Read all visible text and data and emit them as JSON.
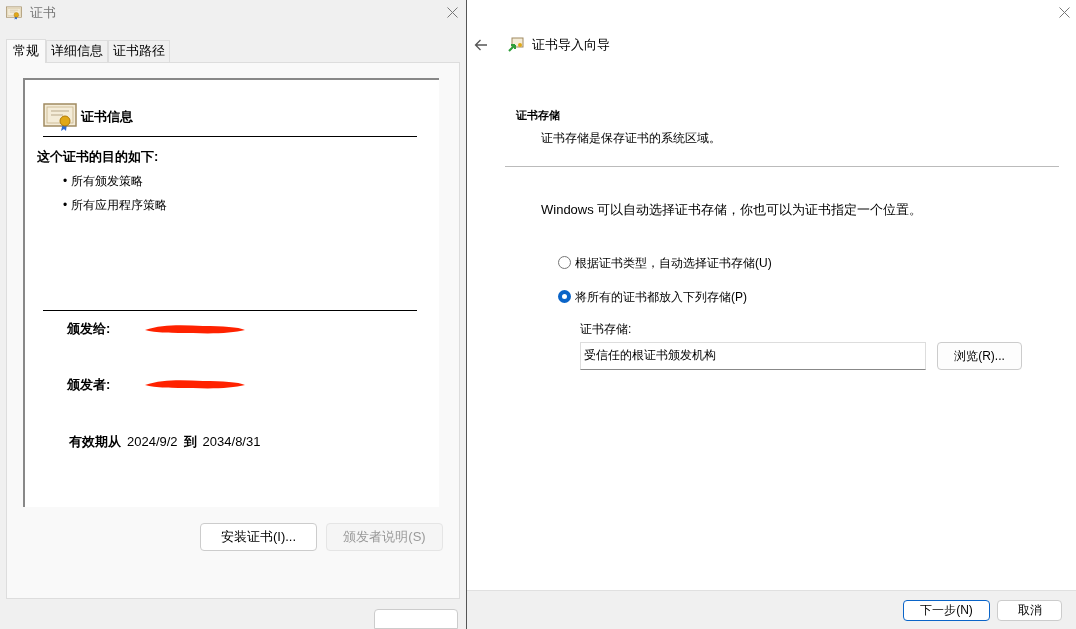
{
  "cert_dialog": {
    "title": "证书",
    "tabs": [
      {
        "label": "常规",
        "selected": true
      },
      {
        "label": "详细信息",
        "selected": false
      },
      {
        "label": "证书路径",
        "selected": false
      }
    ],
    "info_title": "证书信息",
    "purpose_heading": "这个证书的目的如下:",
    "purposes": [
      "• 所有颁发策略",
      "• 所有应用程序策略"
    ],
    "fields": [
      {
        "label": "颁发给:",
        "redacted": true
      },
      {
        "label": "颁发者:",
        "redacted": true
      }
    ],
    "validity": {
      "from_label": "有效期从",
      "from": "2024/9/2",
      "to_label": "到",
      "to": "2034/8/31"
    },
    "buttons": [
      {
        "label": "安装证书(I)...",
        "disabled": false
      },
      {
        "label": "颁发者说明(S)",
        "disabled": true
      }
    ]
  },
  "wizard": {
    "title": "证书导入向导",
    "section_title": "证书存储",
    "section_desc": "证书存储是保存证书的系统区域。",
    "intro": "Windows 可以自动选择证书存储，你也可以为证书指定一个位置。",
    "options": [
      {
        "label": "根据证书类型，自动选择证书存储(U)",
        "selected": false
      },
      {
        "label": "将所有的证书都放入下列存储(P)",
        "selected": true
      }
    ],
    "store_label": "证书存储:",
    "store_value": "受信任的根证书颁发机构",
    "browse_button": "浏览(R)...",
    "footer_buttons": [
      {
        "label": "下一步(N)",
        "default": true
      },
      {
        "label": "取消",
        "default": false
      }
    ]
  }
}
